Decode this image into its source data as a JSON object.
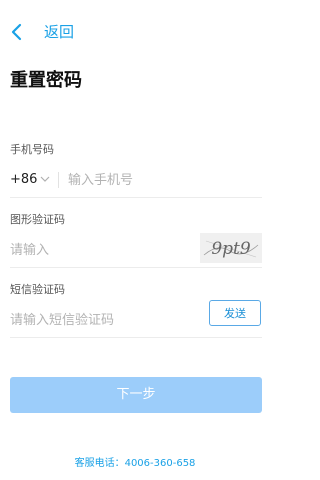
{
  "header": {
    "back_label": "返回",
    "title": "重置密码"
  },
  "phone": {
    "label": "手机号码",
    "country_code": "+86",
    "placeholder": "输入手机号"
  },
  "captcha": {
    "label": "图形验证码",
    "placeholder": "请输入",
    "image_text": "9pt9"
  },
  "sms": {
    "label": "短信验证码",
    "placeholder": "请输入短信验证码",
    "send_label": "发送"
  },
  "actions": {
    "next_label": "下一步"
  },
  "footer": {
    "hotline": "客服电话：4006-360-658"
  },
  "colors": {
    "accent": "#1aa1e6",
    "button_disabled": "#9ccdfa"
  }
}
